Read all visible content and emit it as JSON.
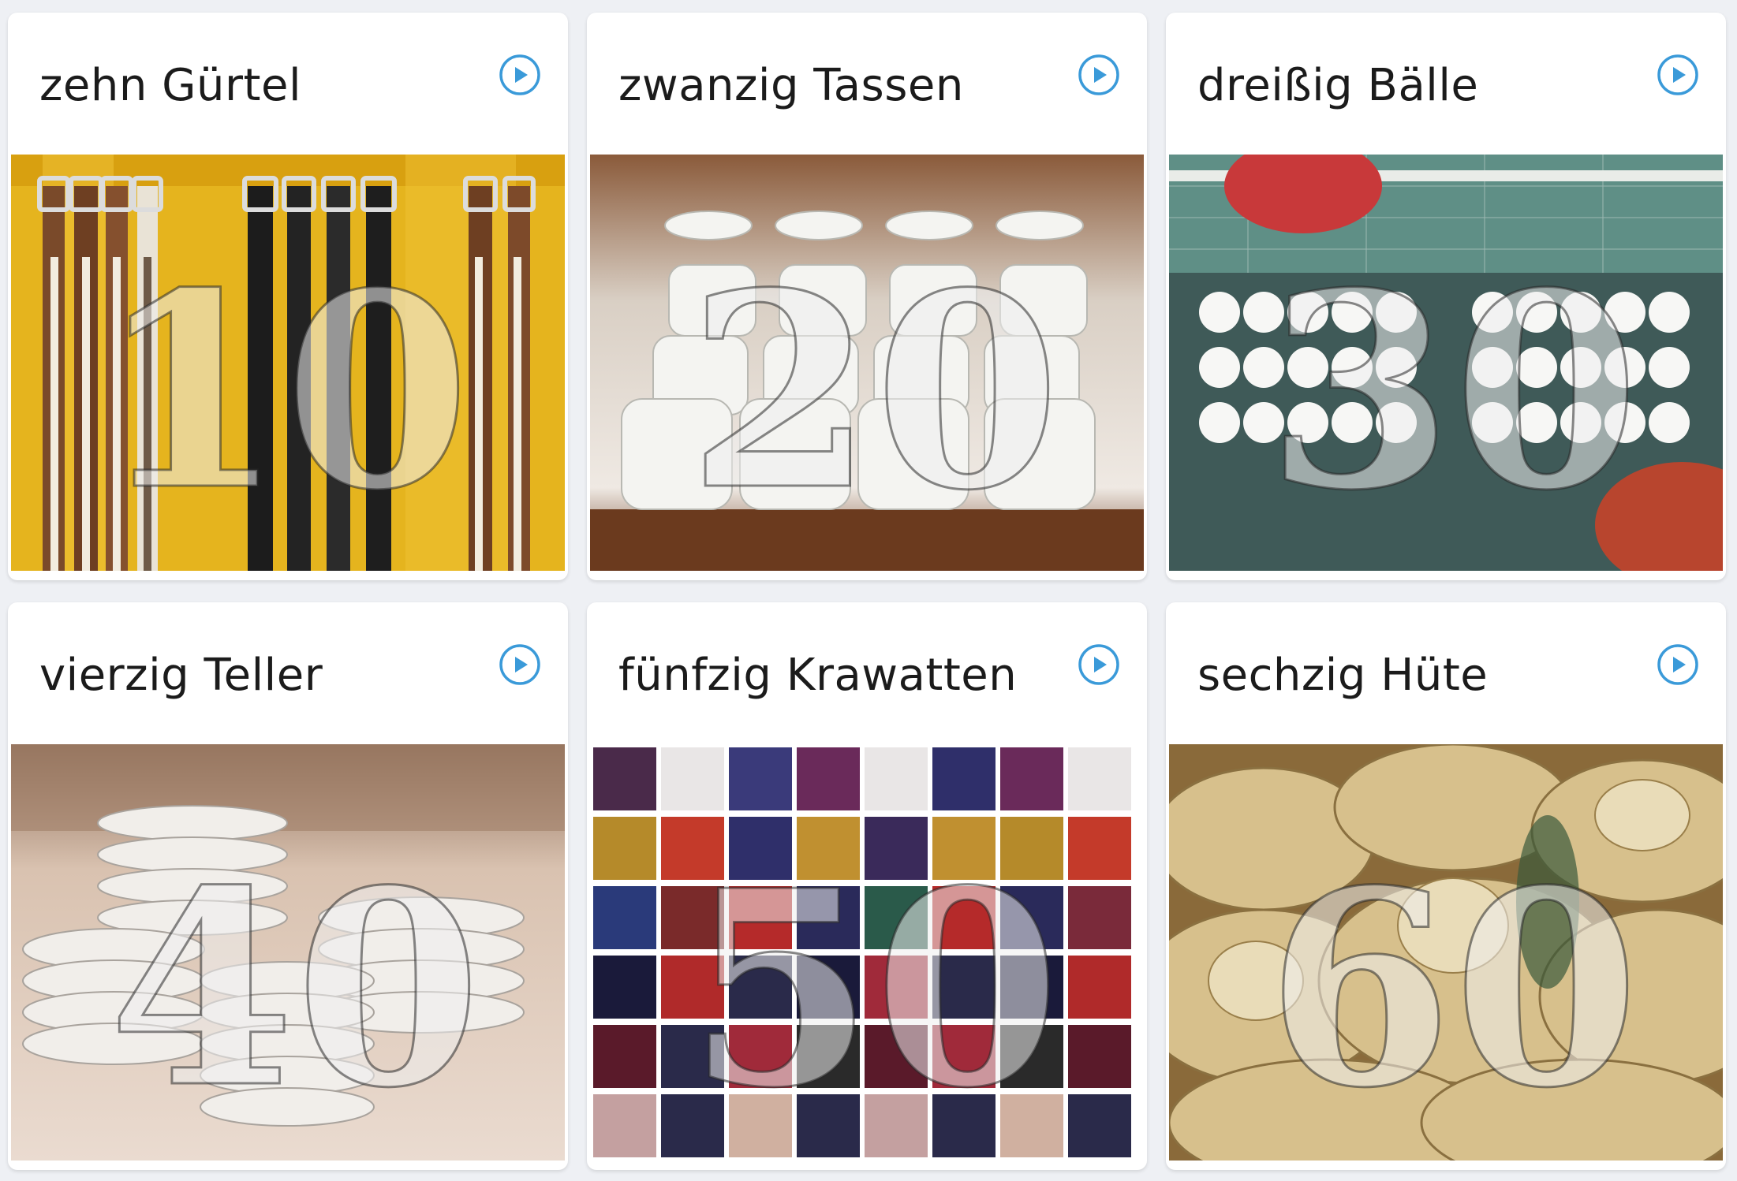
{
  "cards": [
    {
      "title": "zehn Gürtel",
      "number": "10",
      "image": "belts-photo"
    },
    {
      "title": "zwanzig Tassen",
      "number": "20",
      "image": "cups-photo"
    },
    {
      "title": "dreißig Bälle",
      "number": "30",
      "image": "balls-photo"
    },
    {
      "title": "vierzig Teller",
      "number": "40",
      "image": "plates-photo"
    },
    {
      "title": "fünfzig Krawatten",
      "number": "50",
      "image": "ties-photo"
    },
    {
      "title": "sechzig Hüte",
      "number": "60",
      "image": "hats-photo"
    }
  ],
  "icons": {
    "play": "play-circle-icon"
  },
  "colors": {
    "accent": "#3a9ad9",
    "background": "#eef0f4",
    "card": "#ffffff"
  }
}
